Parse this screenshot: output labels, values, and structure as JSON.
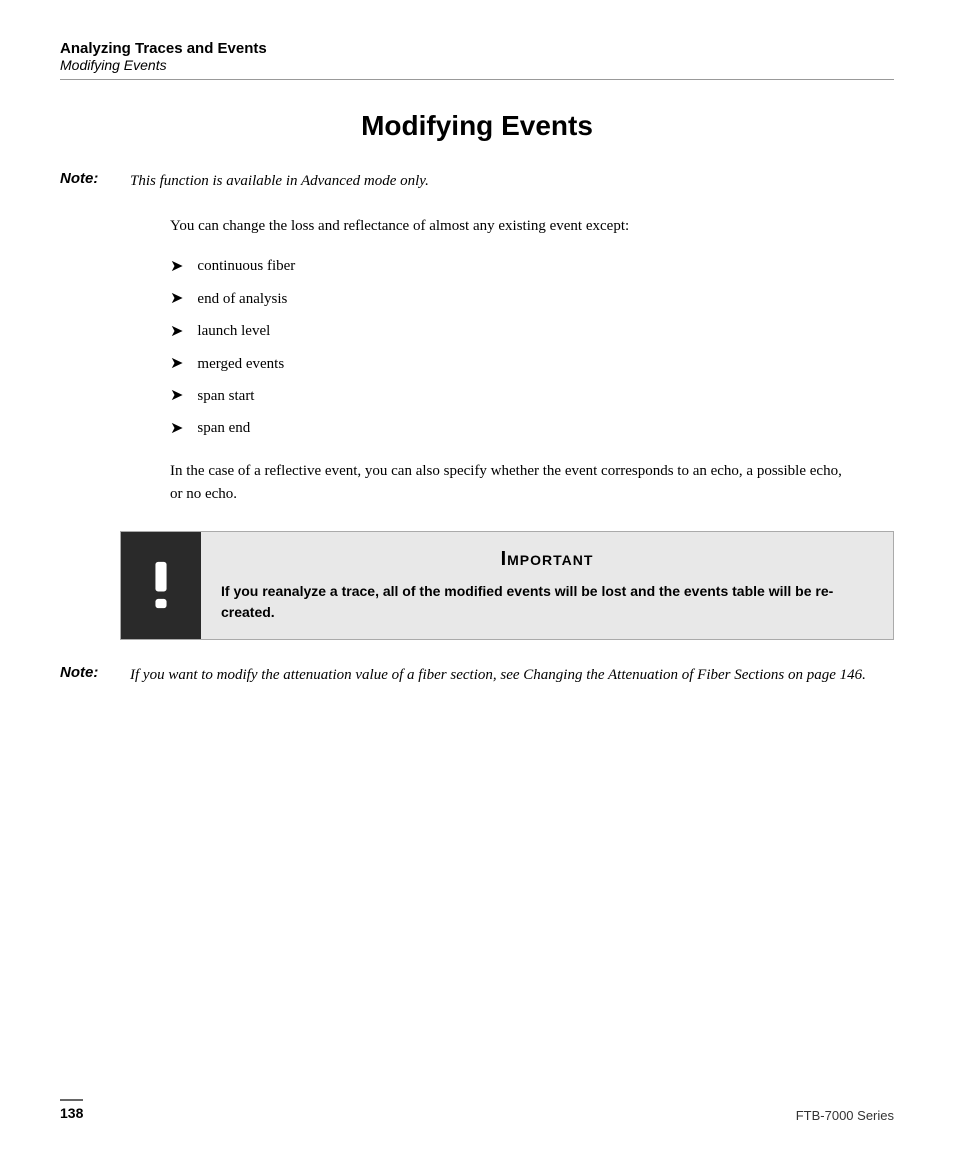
{
  "header": {
    "title": "Analyzing Traces and Events",
    "subtitle": "Modifying Events",
    "divider": true
  },
  "page_title": "Modifying Events",
  "note1": {
    "label": "Note:",
    "text": "This function is available in Advanced mode only."
  },
  "content": {
    "intro_text": "You can change the loss and reflectance of almost any existing event except:",
    "bullet_items": [
      "continuous fiber",
      "end of analysis",
      "launch level",
      "merged events",
      "span start",
      "span end"
    ],
    "after_list_text": "In the case of a reflective event, you can also specify whether the event corresponds to an echo, a possible echo, or no echo."
  },
  "important": {
    "heading": "Important",
    "text": "If you reanalyze a trace, all of the modified events will be lost and the events table will be re-created."
  },
  "note2": {
    "label": "Note:",
    "text_before_link": "If you want to modify the attenuation value of a fiber section, see ",
    "link_text": "Changing the Attenuation of Fiber Sections",
    "text_after_link": " on page 146."
  },
  "footer": {
    "page_number": "138",
    "series": "FTB-7000 Series"
  },
  "icons": {
    "bullet_arrow": "➤",
    "important_icon": "!"
  }
}
